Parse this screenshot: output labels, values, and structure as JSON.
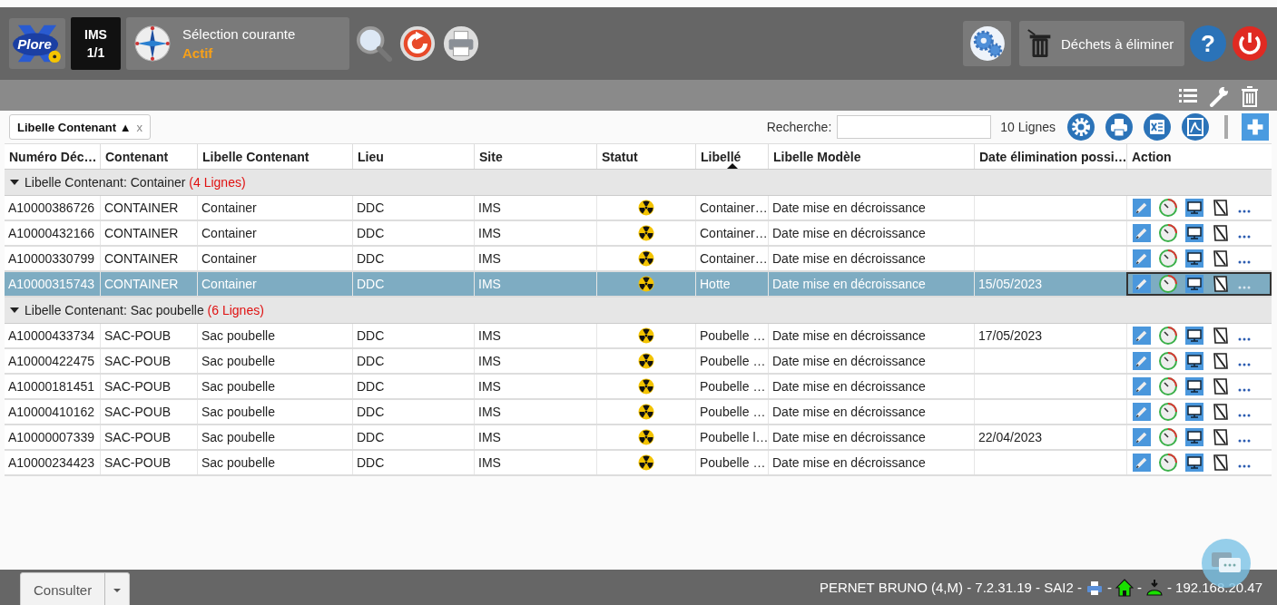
{
  "header": {
    "logo_text": "Plore",
    "site": "IMS",
    "site_count": "1/1",
    "selection_title": "Sélection courante",
    "selection_status": "Actif",
    "waste_button": "Déchets à éliminer",
    "help": "?"
  },
  "group_chip": {
    "label": "Libelle Contenant",
    "sort": "▲",
    "remove": "x"
  },
  "search": {
    "label": "Recherche:"
  },
  "row_count": "10 Lignes",
  "table": {
    "columns": [
      "Numéro Déc…",
      "Contenant",
      "Libelle Contenant",
      "Lieu",
      "Site",
      "Statut",
      "Libellé",
      "Libelle Modèle",
      "Date élimination possi…",
      "Action"
    ],
    "groups": [
      {
        "label": "Libelle Contenant: Container",
        "count": "(4 Lignes)",
        "expanded": true,
        "rows": [
          {
            "numero": "A10000386726",
            "contenant": "CONTAINER",
            "libelle_contenant": "Container",
            "lieu": "DDC",
            "site": "IMS",
            "libelle": "Container…",
            "libelle_modele": "Date mise en décroissance",
            "date": "",
            "selected": false
          },
          {
            "numero": "A10000432166",
            "contenant": "CONTAINER",
            "libelle_contenant": "Container",
            "lieu": "DDC",
            "site": "IMS",
            "libelle": "Container…",
            "libelle_modele": "Date mise en décroissance",
            "date": "",
            "selected": false
          },
          {
            "numero": "A10000330799",
            "contenant": "CONTAINER",
            "libelle_contenant": "Container",
            "lieu": "DDC",
            "site": "IMS",
            "libelle": "Container…",
            "libelle_modele": "Date mise en décroissance",
            "date": "",
            "selected": false
          },
          {
            "numero": "A10000315743",
            "contenant": "CONTAINER",
            "libelle_contenant": "Container",
            "lieu": "DDC",
            "site": "IMS",
            "libelle": "Hotte",
            "libelle_modele": "Date mise en décroissance",
            "date": "15/05/2023",
            "selected": true
          }
        ]
      },
      {
        "label": "Libelle Contenant: Sac poubelle",
        "count": "(6 Lignes)",
        "expanded": true,
        "rows": [
          {
            "numero": "A10000433734",
            "contenant": "SAC-POUB",
            "libelle_contenant": "Sac poubelle",
            "lieu": "DDC",
            "site": "IMS",
            "libelle": "Poubelle …",
            "libelle_modele": "Date mise en décroissance",
            "date": "17/05/2023",
            "selected": false
          },
          {
            "numero": "A10000422475",
            "contenant": "SAC-POUB",
            "libelle_contenant": "Sac poubelle",
            "lieu": "DDC",
            "site": "IMS",
            "libelle": "Poubelle …",
            "libelle_modele": "Date mise en décroissance",
            "date": "",
            "selected": false
          },
          {
            "numero": "A10000181451",
            "contenant": "SAC-POUB",
            "libelle_contenant": "Sac poubelle",
            "lieu": "DDC",
            "site": "IMS",
            "libelle": "Poubelle …",
            "libelle_modele": "Date mise en décroissance",
            "date": "",
            "selected": false
          },
          {
            "numero": "A10000410162",
            "contenant": "SAC-POUB",
            "libelle_contenant": "Sac poubelle",
            "lieu": "DDC",
            "site": "IMS",
            "libelle": "Poubelle …",
            "libelle_modele": "Date mise en décroissance",
            "date": "",
            "selected": false
          },
          {
            "numero": "A10000007339",
            "contenant": "SAC-POUB",
            "libelle_contenant": "Sac poubelle",
            "lieu": "DDC",
            "site": "IMS",
            "libelle": "Poubelle l…",
            "libelle_modele": "Date mise en décroissance",
            "date": "22/04/2023",
            "selected": false
          },
          {
            "numero": "A10000234423",
            "contenant": "SAC-POUB",
            "libelle_contenant": "Sac poubelle",
            "lieu": "DDC",
            "site": "IMS",
            "libelle": "Poubelle …",
            "libelle_modele": "Date mise en décroissance",
            "date": "",
            "selected": false
          }
        ]
      }
    ]
  },
  "footer": {
    "button": "Consulter",
    "user_info": "PERNET BRUNO (4,M) - 7.2.31.19 - SAI2 -",
    "separator_1": "-",
    "separator_2": "-",
    "ip": "- 192.168.20.47"
  }
}
